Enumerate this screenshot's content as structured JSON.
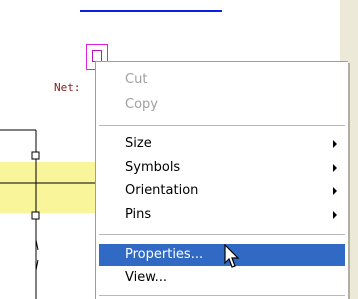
{
  "schematic": {
    "net_label": "Net:",
    "component_icon": "schematic-component-icon",
    "colors": {
      "wire": "#000000",
      "highlight": "#f9f59a",
      "net_label": "#8b1a1a",
      "component": "#e020e0",
      "top_line": "#0b1fe0"
    }
  },
  "context_menu": {
    "cut_label": "Cut",
    "copy_label": "Copy",
    "size_label": "Size",
    "symbols_label": "Symbols",
    "orientation_label": "Orientation",
    "pins_label": "Pins",
    "properties_label": "Properties...",
    "view_label": "View...",
    "selected_item": "Properties...",
    "submenu_icon": "chevron-right-icon",
    "highlight_color": "#316ac5"
  },
  "cursor": {
    "icon": "mouse-pointer-icon"
  }
}
